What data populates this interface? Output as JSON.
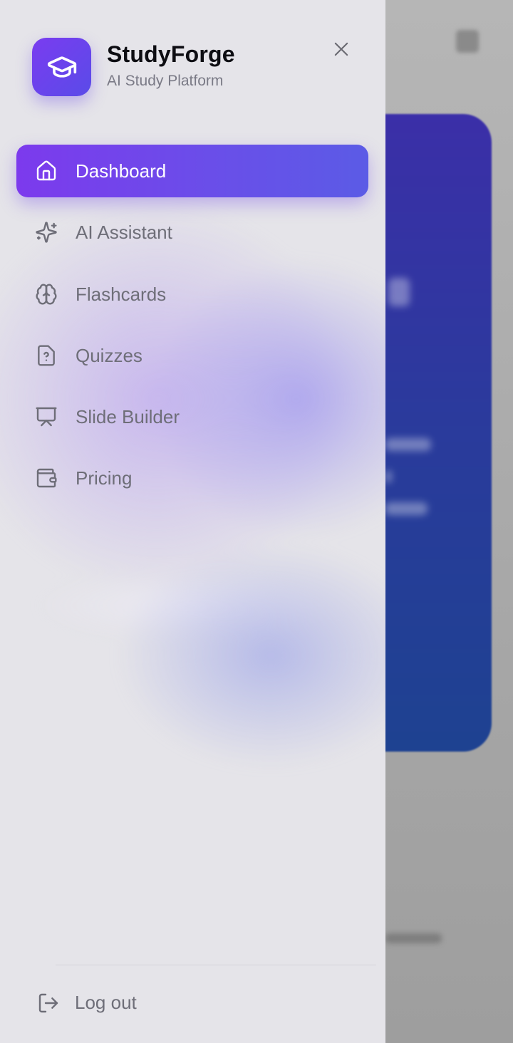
{
  "brand": {
    "title": "StudyForge",
    "subtitle": "AI Study Platform",
    "logo_icon": "graduation-cap-icon"
  },
  "header": {
    "close_icon": "close-icon"
  },
  "nav": {
    "items": [
      {
        "label": "Dashboard",
        "icon": "home-icon",
        "active": true
      },
      {
        "label": "AI Assistant",
        "icon": "sparkles-icon",
        "active": false
      },
      {
        "label": "Flashcards",
        "icon": "brain-icon",
        "active": false
      },
      {
        "label": "Quizzes",
        "icon": "file-question-icon",
        "active": false
      },
      {
        "label": "Slide Builder",
        "icon": "presentation-icon",
        "active": false
      },
      {
        "label": "Pricing",
        "icon": "wallet-icon",
        "active": false
      }
    ]
  },
  "footer": {
    "logout_label": "Log out",
    "logout_icon": "log-out-icon"
  },
  "colors": {
    "accent_start": "#7c3aed",
    "accent_end": "#5b5be6",
    "drawer_bg": "#e5e4e9",
    "text_muted": "#6e6e78",
    "title_text": "#0d0d12"
  }
}
